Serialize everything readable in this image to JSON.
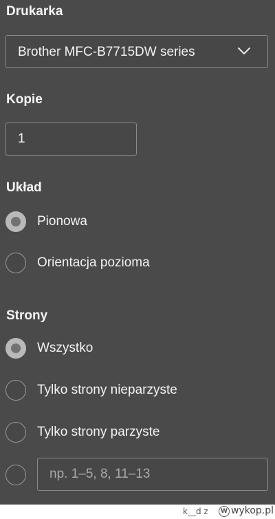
{
  "printer": {
    "heading": "Drukarka",
    "selected": "Brother MFC-B7715DW series"
  },
  "copies": {
    "heading": "Kopie",
    "value": "1"
  },
  "layout": {
    "heading": "Układ",
    "options": [
      {
        "label": "Pionowa",
        "checked": true
      },
      {
        "label": "Orientacja pozioma",
        "checked": false
      }
    ]
  },
  "pages": {
    "heading": "Strony",
    "options": [
      {
        "label": "Wszystko",
        "checked": true
      },
      {
        "label": "Tylko strony nieparzyste",
        "checked": false
      },
      {
        "label": "Tylko strony parzyste",
        "checked": false
      }
    ],
    "range_placeholder": "np. 1–5, 8, 11–13"
  },
  "watermark": {
    "user": "k__d z",
    "logo_letter": "W",
    "site": "wykop.pl"
  },
  "colors": {
    "panel_background": "#4a4a4a",
    "text": "#f2f2f2",
    "border": "#8a8a8a",
    "radio_checked": "#b9b9b9"
  }
}
